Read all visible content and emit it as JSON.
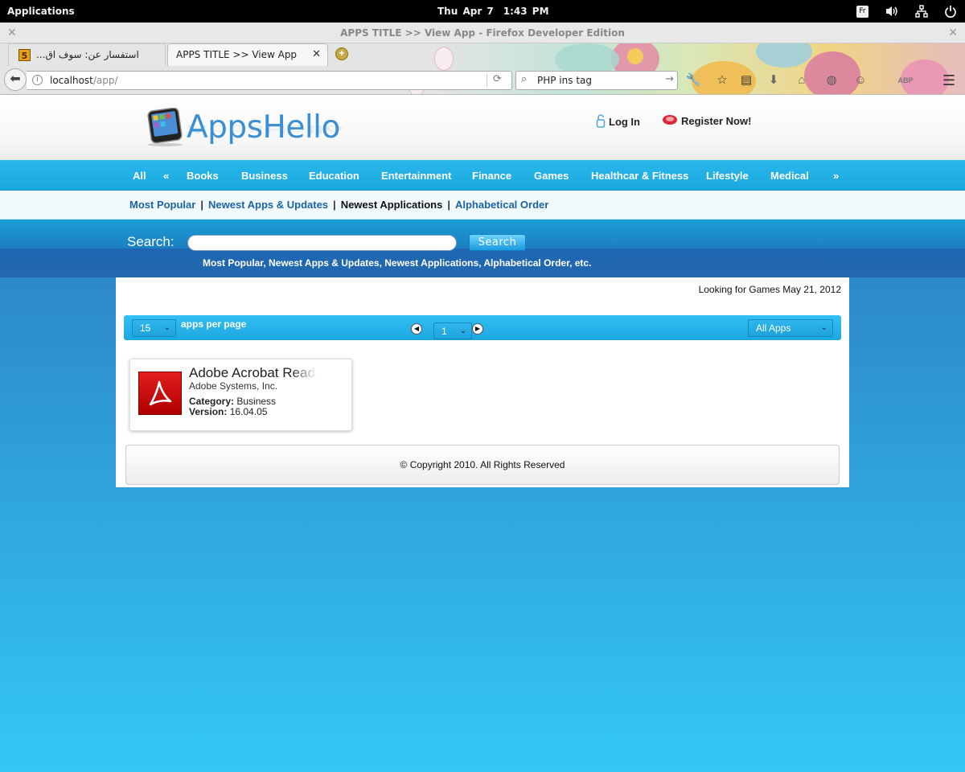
{
  "topbar": {
    "applications": "Applications",
    "day": "Thu Apr  7",
    "time": "1:43 PM",
    "lang": "Fr"
  },
  "browser": {
    "window_title": "APPS TITLE >> View App - Firefox Developer Edition",
    "tabs": [
      {
        "label": "استفسار عن: سوف اق...",
        "favicon": "5"
      },
      {
        "label": "APPS TITLE >> View App"
      }
    ],
    "url_host": "localhost",
    "url_path": "/app/",
    "search_query": "PHP ins tag"
  },
  "site": {
    "logo_text": "AppsHello",
    "login": "Log In",
    "register": "Register Now!",
    "categories": [
      "All",
      "«",
      "Books",
      "Business",
      "Education",
      "Entertainment",
      "Finance",
      "Games",
      "Healthcar & Fitness",
      "Lifestyle",
      "Medical",
      "»"
    ],
    "subnav": [
      "Most Popular",
      "Newest Apps & Updates",
      "Newest Applications",
      "Alphabetical Order"
    ],
    "subnav_sep": "|",
    "search_label": "Search:",
    "search_button": "Search",
    "search_links": "Most Popular,  Newest Apps & Updates,  Newest Applications,  Alphabetical Order,  etc.",
    "looking_for": "Looking for Games May 21, 2012",
    "per_page_value": "15",
    "per_page_label": "apps per page",
    "page_value": "1",
    "filter_value": "All Apps",
    "app": {
      "name": "Adobe Acrobat Reader",
      "developer": "Adobe Systems, Inc.",
      "category_label": "Category:",
      "category": "Business",
      "version_label": "Version:",
      "version": "16.04.05"
    },
    "copyright": "© Copyright 2010. All Rights Reserved"
  },
  "colors": {
    "nav_blue": "#19a7dd",
    "logo_blue": "#3c8fd0",
    "link_blue": "#1e62a3",
    "page_bottom": "#33c8f6",
    "acrobat_red": "#c80f0f"
  },
  "icons": [
    "back-arrow-icon",
    "info-icon",
    "reload-icon",
    "search-icon",
    "wrench-icon",
    "star-icon",
    "reader-icon",
    "download-icon",
    "home-icon",
    "globe-icon",
    "smiley-icon",
    "adblock-icon",
    "menu-icon",
    "lock-icon",
    "register-icon",
    "volume-icon",
    "network-icon",
    "power-icon"
  ]
}
